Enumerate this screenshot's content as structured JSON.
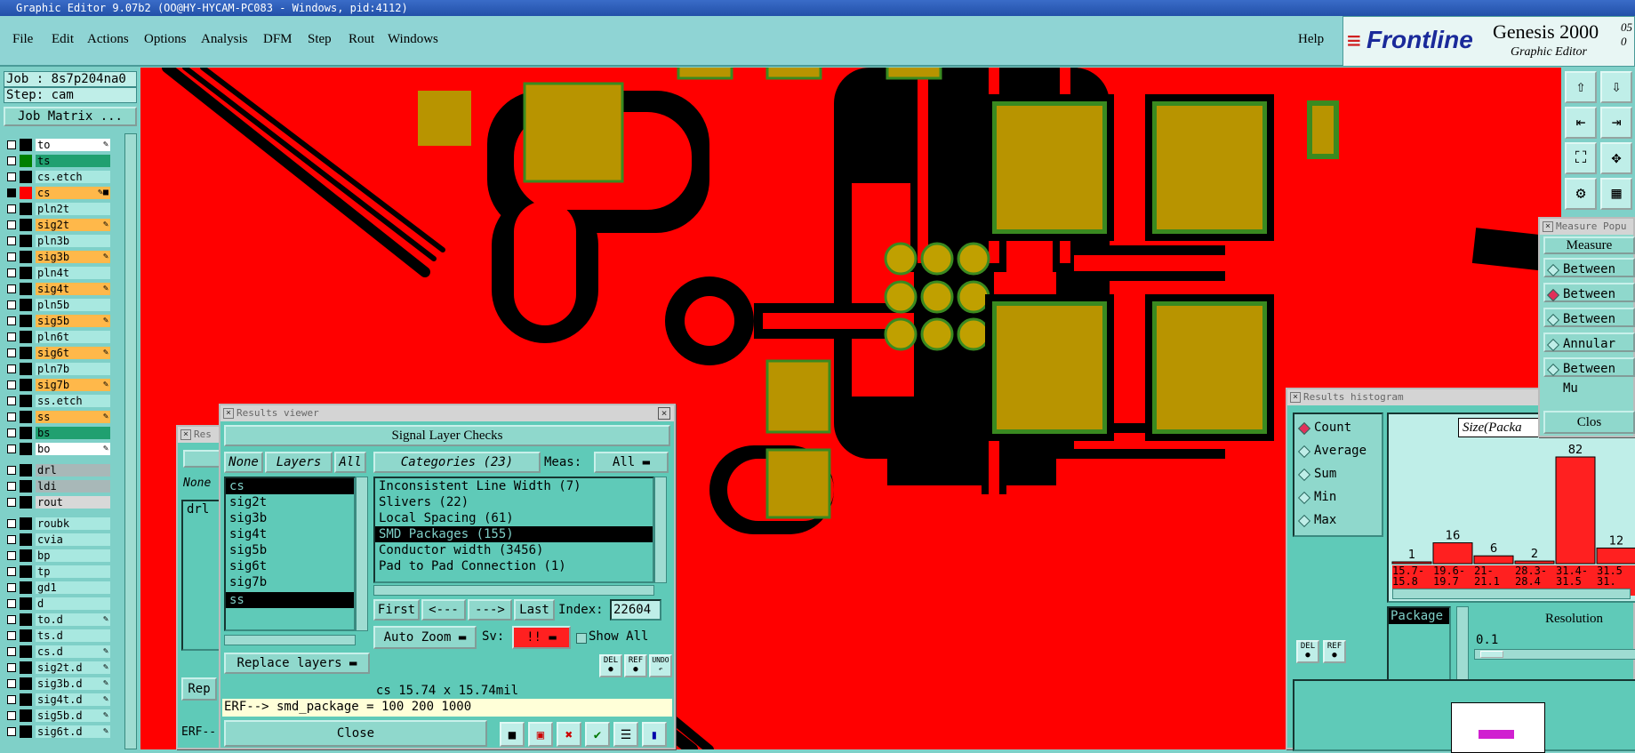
{
  "titlebar": {
    "text": "Graphic Editor 9.07b2 (OO@HY-HYCAM-PC083 - Windows, pid:4112)"
  },
  "menu": [
    "File",
    "Edit",
    "Actions",
    "Options",
    "Analysis",
    "DFM",
    "Step",
    "Rout",
    "Windows"
  ],
  "help": "Help",
  "logo": {
    "brand": "Frontline",
    "product": "Genesis 2000",
    "subtitle": "Graphic Editor",
    "corner": "05 0"
  },
  "job": {
    "job": "Job : 8s7p204na0",
    "step": "Step: cam",
    "matrix_button": "Job Matrix ..."
  },
  "layers": [
    {
      "name": "to",
      "swatch": "#000000",
      "bg": "#ffffff",
      "tag": "✎"
    },
    {
      "name": "ts",
      "swatch": "#008000",
      "bg": "#20a070",
      "tag": ""
    },
    {
      "name": "cs.etch",
      "swatch": "#000000",
      "bg": "#a8e8e0",
      "tag": ""
    },
    {
      "name": "cs",
      "swatch": "#ff0000",
      "bg": "#ffb84a",
      "tag": "✎■"
    },
    {
      "name": "pln2t",
      "swatch": "#000000",
      "bg": "#a8e8e0",
      "tag": ""
    },
    {
      "name": "sig2t",
      "swatch": "#000000",
      "bg": "#ffb84a",
      "tag": "✎"
    },
    {
      "name": "pln3b",
      "swatch": "#000000",
      "bg": "#a8e8e0",
      "tag": ""
    },
    {
      "name": "sig3b",
      "swatch": "#000000",
      "bg": "#ffb84a",
      "tag": "✎"
    },
    {
      "name": "pln4t",
      "swatch": "#000000",
      "bg": "#a8e8e0",
      "tag": ""
    },
    {
      "name": "sig4t",
      "swatch": "#000000",
      "bg": "#ffb84a",
      "tag": "✎"
    },
    {
      "name": "pln5b",
      "swatch": "#000000",
      "bg": "#a8e8e0",
      "tag": ""
    },
    {
      "name": "sig5b",
      "swatch": "#000000",
      "bg": "#ffb84a",
      "tag": "✎"
    },
    {
      "name": "pln6t",
      "swatch": "#000000",
      "bg": "#a8e8e0",
      "tag": ""
    },
    {
      "name": "sig6t",
      "swatch": "#000000",
      "bg": "#ffb84a",
      "tag": "✎"
    },
    {
      "name": "pln7b",
      "swatch": "#000000",
      "bg": "#a8e8e0",
      "tag": ""
    },
    {
      "name": "sig7b",
      "swatch": "#000000",
      "bg": "#ffb84a",
      "tag": "✎"
    },
    {
      "name": "ss.etch",
      "swatch": "#000000",
      "bg": "#a8e8e0",
      "tag": ""
    },
    {
      "name": "ss",
      "swatch": "#000000",
      "bg": "#ffb84a",
      "tag": "✎"
    },
    {
      "name": "bs",
      "swatch": "#000000",
      "bg": "#20a070",
      "tag": ""
    },
    {
      "name": "bo",
      "swatch": "#000000",
      "bg": "#ffffff",
      "tag": "✎"
    },
    {
      "name": "drl",
      "swatch": "#000000",
      "bg": "#a8b8b8",
      "tag": ""
    },
    {
      "name": "ldi",
      "swatch": "#000000",
      "bg": "#a8b8b8",
      "tag": ""
    },
    {
      "name": "rout",
      "swatch": "#000000",
      "bg": "#d8d8d8",
      "tag": ""
    },
    {
      "name": "roubk",
      "swatch": "#000000",
      "bg": "#a8e8e0",
      "tag": ""
    },
    {
      "name": "cvia",
      "swatch": "#000000",
      "bg": "#a8e8e0",
      "tag": ""
    },
    {
      "name": "bp",
      "swatch": "#000000",
      "bg": "#a8e8e0",
      "tag": ""
    },
    {
      "name": "tp",
      "swatch": "#000000",
      "bg": "#a8e8e0",
      "tag": ""
    },
    {
      "name": "gd1",
      "swatch": "#000000",
      "bg": "#a8e8e0",
      "tag": ""
    },
    {
      "name": "d",
      "swatch": "#000000",
      "bg": "#a8e8e0",
      "tag": ""
    },
    {
      "name": "to.d",
      "swatch": "#000000",
      "bg": "#a8e8e0",
      "tag": "✎"
    },
    {
      "name": "ts.d",
      "swatch": "#000000",
      "bg": "#a8e8e0",
      "tag": ""
    },
    {
      "name": "cs.d",
      "swatch": "#000000",
      "bg": "#a8e8e0",
      "tag": "✎"
    },
    {
      "name": "sig2t.d",
      "swatch": "#000000",
      "bg": "#a8e8e0",
      "tag": "✎"
    },
    {
      "name": "sig3b.d",
      "swatch": "#000000",
      "bg": "#a8e8e0",
      "tag": "✎"
    },
    {
      "name": "sig4t.d",
      "swatch": "#000000",
      "bg": "#a8e8e0",
      "tag": "✎"
    },
    {
      "name": "sig5b.d",
      "swatch": "#000000",
      "bg": "#a8e8e0",
      "tag": "✎"
    },
    {
      "name": "sig6t.d",
      "swatch": "#000000",
      "bg": "#a8e8e0",
      "tag": "✎"
    }
  ],
  "results_viewer": {
    "title": "Results viewer",
    "header": "Signal Layer Checks",
    "none_btn": "None",
    "layers_btn": "Layers",
    "all_btn": "All",
    "layer_list": [
      "cs",
      "sig2t",
      "sig3b",
      "sig4t",
      "sig5b",
      "sig6t",
      "sig7b",
      "ss"
    ],
    "categories_btn": "Categories (23)",
    "meas_label": "Meas:",
    "meas_value": "All",
    "categories": [
      "Inconsistent Line Width (7)",
      "Slivers (22)",
      "Local Spacing (61)",
      "SMD Packages (155)",
      "Conductor width (3456)",
      "Pad to Pad Connection (1)"
    ],
    "first": "First",
    "prev": "<---",
    "next": "--->",
    "last": "Last",
    "index_label": "Index:",
    "index_value": "22604",
    "auto_zoom": "Auto Zoom",
    "sv_label": "Sv:",
    "sv_value": "!!",
    "show_all": "Show All",
    "replace_layers": "Replace layers",
    "del": "DEL",
    "ref": "REF",
    "undo": "UNDO",
    "status": "cs 15.74 x 15.74mil",
    "erf": "ERF--> smd_package = 100 200 1000",
    "close": "Close"
  },
  "back_window": {
    "title": "Res",
    "none_btn": "None",
    "list_item": "drl",
    "rep_btn": "Rep",
    "erf": "ERF--"
  },
  "histogram": {
    "title": "Results histogram",
    "options": [
      "Count",
      "Average",
      "Sum",
      "Min",
      "Max"
    ],
    "size_label": "Size(Packa",
    "bars": [
      1,
      16,
      6,
      2,
      82,
      12
    ],
    "ranges": [
      "15.7-\n15.8",
      "19.6-\n19.7",
      "21-\n21.1",
      "28.3-\n28.4",
      "31.4-\n31.5",
      "31.5\n31."
    ],
    "package_label": "Package",
    "resolution_label": "Resolution",
    "resolution_value": "0.1",
    "del": "DEL",
    "ref": "REF"
  },
  "measure": {
    "title": "Measure Popu",
    "header": "Measure",
    "options": [
      "Between Po",
      "Between Ce",
      "Between Ne",
      "Annular Ri",
      "Between Mu"
    ],
    "selected": 1,
    "close": "Clos"
  },
  "colors": {
    "copper": "#ff0000",
    "pad": "#b89400",
    "pad_border": "#3a8a20",
    "trace": "#000000",
    "panel": "#5fcab8"
  }
}
